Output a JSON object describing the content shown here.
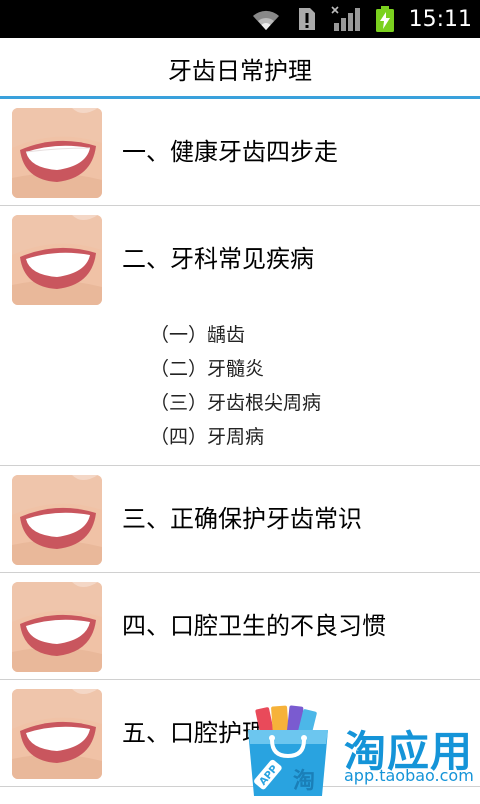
{
  "status_bar": {
    "time": "15:11",
    "icons": [
      "wifi-icon",
      "sim-alert-icon",
      "signal-icon",
      "battery-charging-icon"
    ]
  },
  "header": {
    "title": "牙齿日常护理"
  },
  "list": {
    "items": [
      {
        "title": "一、健康牙齿四步走"
      },
      {
        "title": "二、牙科常见疾病",
        "subitems": [
          "（一）龋齿",
          "（二）牙髓炎",
          "（三）牙齿根尖周病",
          "（四）牙周病"
        ]
      },
      {
        "title": "三、正确保护牙齿常识"
      },
      {
        "title": "四、口腔卫生的不良习惯"
      },
      {
        "title": "五、口腔护理"
      }
    ]
  },
  "ad": {
    "brand": "淘应用",
    "url": "app.taobao.com",
    "bag_text": "APP",
    "bag_char": "淘",
    "colors": {
      "brand_blue": "#1594d8"
    }
  },
  "colors": {
    "accent": "#3aa1dc",
    "divider": "#d0d0d0"
  }
}
